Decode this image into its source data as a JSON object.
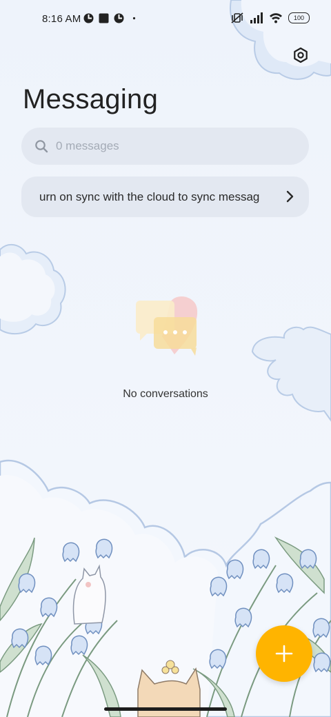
{
  "status_bar": {
    "time": "8:16 AM",
    "battery": "100",
    "left_icons": [
      "app-notification-icon",
      "square-notification-icon",
      "app-notification-icon",
      "dot-icon"
    ],
    "right_icons": [
      "muted-vibrate-icon",
      "signal-icon",
      "wifi-icon",
      "battery-icon"
    ]
  },
  "header": {
    "title": "Messaging",
    "settings_icon": "settings-icon"
  },
  "search": {
    "placeholder": "0 messages",
    "icon": "search-icon"
  },
  "sync_banner": {
    "text": "urn on sync with the cloud to sync messag",
    "icon": "chevron-right-icon"
  },
  "empty_state": {
    "text": "No conversations"
  },
  "fab": {
    "icon": "plus-icon",
    "color": "#ffb400"
  }
}
